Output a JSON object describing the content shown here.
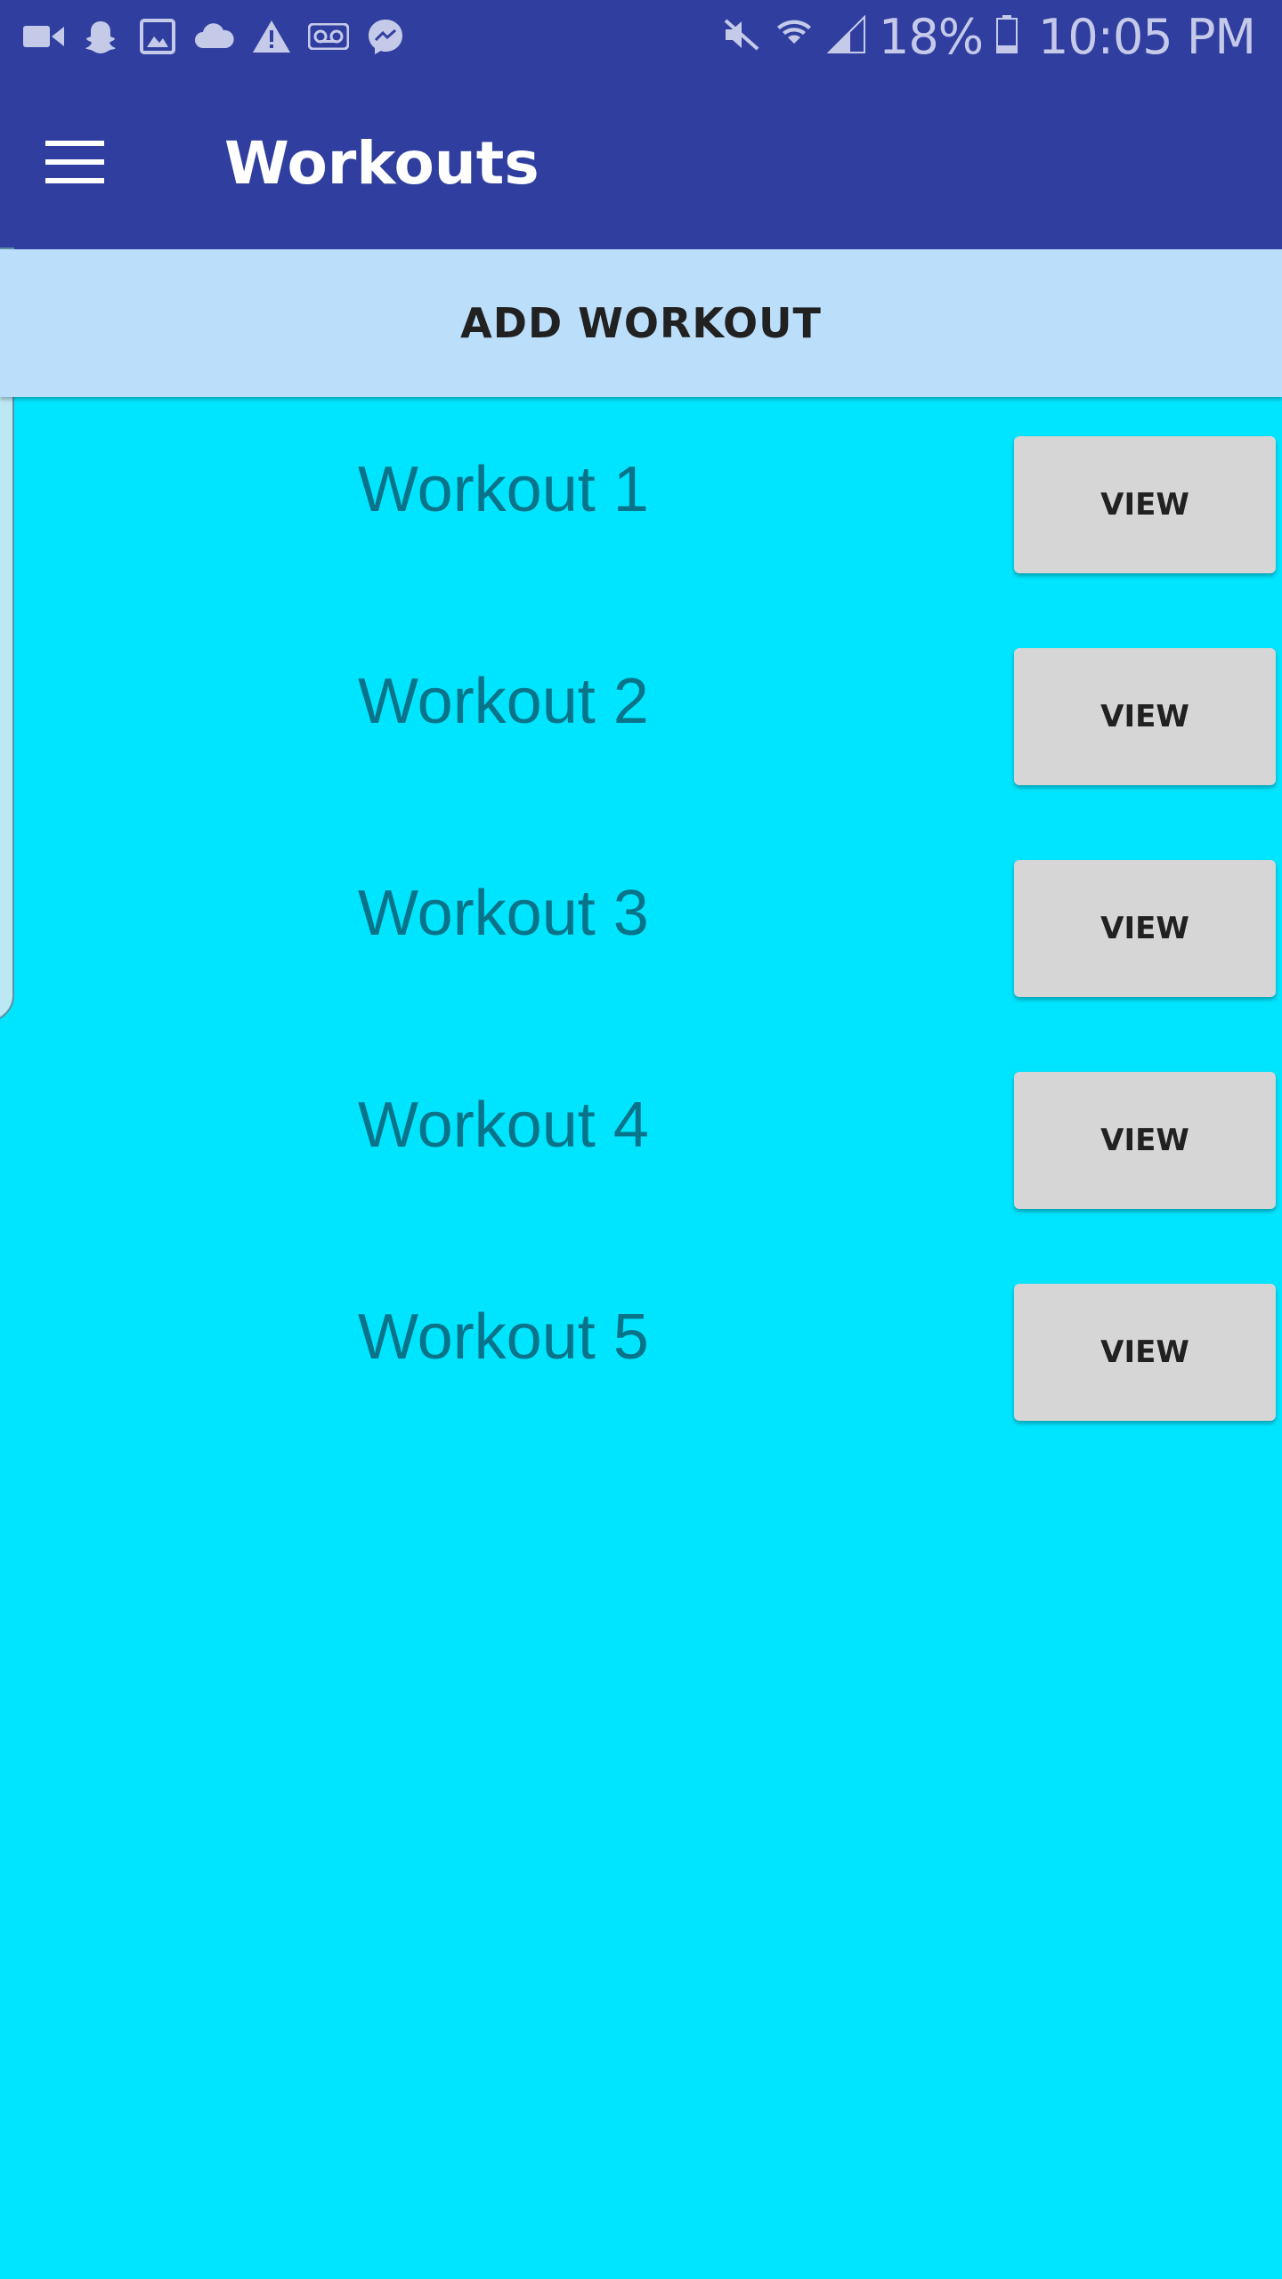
{
  "status_bar": {
    "icons": [
      "video-camera-icon",
      "snapchat-icon",
      "image-icon",
      "cloud-icon",
      "warning-icon",
      "voicemail-icon",
      "messenger-icon"
    ],
    "right_icons": [
      "mute-icon",
      "wifi-icon",
      "signal-icon",
      "battery-icon"
    ],
    "battery_percent": "18%",
    "time": "10:05 PM",
    "color": "#303F9F"
  },
  "app_bar": {
    "title": "Workouts",
    "menu_icon": "hamburger-menu-icon",
    "color": "#303F9F"
  },
  "add_workout": {
    "label": "ADD WORKOUT",
    "color": "#BBDEFB"
  },
  "workouts": [
    {
      "name": "Workout 1",
      "button": "VIEW"
    },
    {
      "name": "Workout 2",
      "button": "VIEW"
    },
    {
      "name": "Workout 3",
      "button": "VIEW"
    },
    {
      "name": "Workout 4",
      "button": "VIEW"
    },
    {
      "name": "Workout 5",
      "button": "VIEW"
    }
  ],
  "colors": {
    "background": "#00E5FF",
    "workout_text": "#087389",
    "button": "#D6D6D6"
  }
}
